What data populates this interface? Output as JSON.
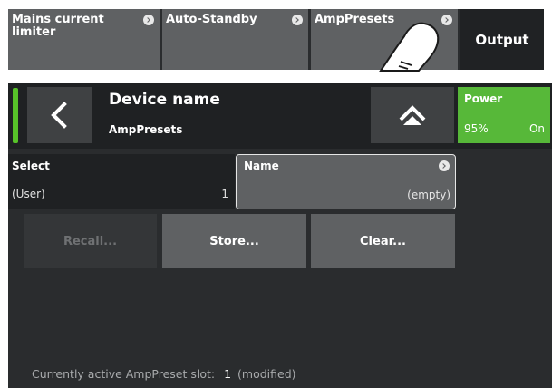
{
  "top_menu": {
    "items": [
      {
        "label": "Mains current limiter",
        "has_arrow": true
      },
      {
        "label": "Auto-Standby",
        "has_arrow": true
      },
      {
        "label": "AmpPresets",
        "has_arrow": true
      }
    ],
    "output_label": "Output"
  },
  "header": {
    "title": "Device name",
    "subtitle": "AmpPresets",
    "indicator_color": "#57c229",
    "back_icon": "chevron-left-icon",
    "home_icon": "home-icon"
  },
  "power": {
    "label": "Power",
    "percent": "95%",
    "state": "On",
    "color": "#57b839"
  },
  "select": {
    "label": "Select",
    "value": "(User)",
    "number": "1"
  },
  "name": {
    "label": "Name",
    "value": "(empty)"
  },
  "actions": {
    "recall": "Recall...",
    "store": "Store...",
    "clear": "Clear..."
  },
  "status": {
    "prefix": "Currently active AmpPreset slot:",
    "slot": "1",
    "suffix": "(modified)"
  },
  "overlay": {
    "icon": "touch-hand-icon"
  }
}
